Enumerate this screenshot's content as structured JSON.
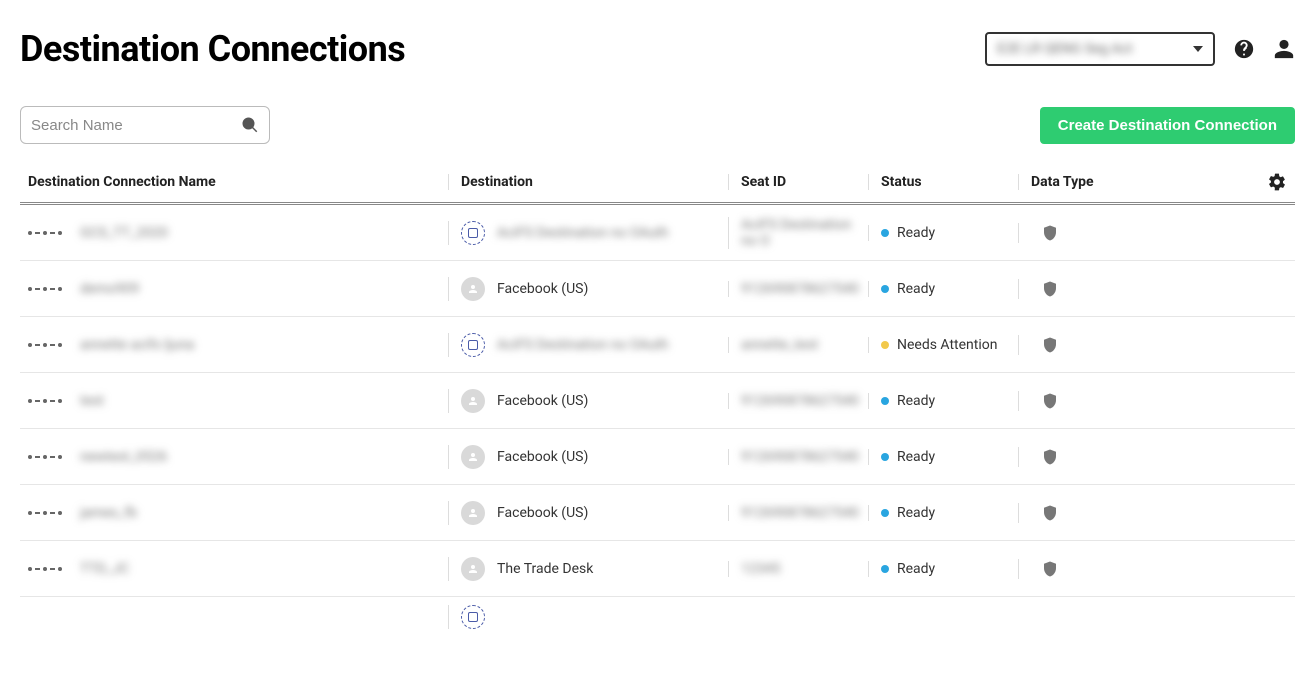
{
  "header": {
    "title": "Destination Connections",
    "account_label": "E2E LR QENG Seg Act"
  },
  "toolbar": {
    "search_placeholder": "Search Name",
    "create_label": "Create Destination Connection"
  },
  "columns": {
    "name": "Destination Connection Name",
    "destination": "Destination",
    "seat": "Seat ID",
    "status": "Status",
    "dtype": "Data Type"
  },
  "status_labels": {
    "ready": "Ready",
    "needs_attention": "Needs Attention"
  },
  "rows": [
    {
      "name": "GCS_TT_2020",
      "name_blurred": true,
      "destination": "AciFS Destination no OAuth",
      "destination_blurred": true,
      "destination_icon": "outlined",
      "seat": "AciFS Destination no O",
      "seat_blurred": true,
      "status": "ready"
    },
    {
      "name": "demo909",
      "name_blurred": true,
      "destination": "Facebook (US)",
      "destination_blurred": false,
      "destination_icon": "gray",
      "seat": "912690878627540",
      "seat_blurred": true,
      "status": "ready"
    },
    {
      "name": "annette acifs ljuna",
      "name_blurred": true,
      "destination": "AciFS Destination no OAuth",
      "destination_blurred": true,
      "destination_icon": "outlined",
      "seat": "annette_test",
      "seat_blurred": true,
      "status": "needs_attention"
    },
    {
      "name": "test",
      "name_blurred": true,
      "destination": "Facebook (US)",
      "destination_blurred": false,
      "destination_icon": "gray",
      "seat": "912690878627540",
      "seat_blurred": true,
      "status": "ready"
    },
    {
      "name": "newtest_0526",
      "name_blurred": true,
      "destination": "Facebook (US)",
      "destination_blurred": false,
      "destination_icon": "gray",
      "seat": "912690878627540",
      "seat_blurred": true,
      "status": "ready"
    },
    {
      "name": "james_fb",
      "name_blurred": true,
      "destination": "Facebook (US)",
      "destination_blurred": false,
      "destination_icon": "gray",
      "seat": "912690878627540",
      "seat_blurred": true,
      "status": "ready"
    },
    {
      "name": "TTD_JC",
      "name_blurred": true,
      "destination": "The Trade Desk",
      "destination_blurred": false,
      "destination_icon": "gray",
      "seat": "12345",
      "seat_blurred": true,
      "status": "ready"
    }
  ]
}
